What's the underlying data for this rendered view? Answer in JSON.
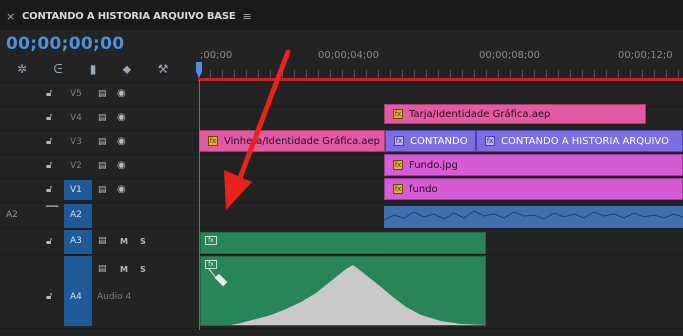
{
  "panel": {
    "close_glyph": "×",
    "title": "CONTANDO A HISTORIA ARQUIVO BASE",
    "menu_glyph": "≡"
  },
  "timecode": "00;00;00;00",
  "tools": [
    {
      "name": "snap-icon",
      "glyph": "✲"
    },
    {
      "name": "linked-selection-icon",
      "glyph": "ᕮ"
    },
    {
      "name": "add-marker-icon",
      "glyph": "▮"
    },
    {
      "name": "marker-icon",
      "glyph": "⬥"
    },
    {
      "name": "wrench-icon",
      "glyph": "⚒"
    }
  ],
  "ruler": {
    "labels": [
      ";00;00",
      "00;00;04;00",
      "00;00;08;00",
      "00;00;12;0"
    ]
  },
  "tracks": {
    "v5": "V5",
    "v4": "V4",
    "v3": "V3",
    "v2": "V2",
    "v1": "V1",
    "a2_source": "A2",
    "a2": "A2",
    "a3": "A3",
    "a4": "A4",
    "audio4_name": "Audio 4",
    "mute": "M",
    "solo": "S"
  },
  "clips": {
    "tarja": "Tarja/Identidade Gráfica.aep",
    "vinheta": "Vinheta/Identidade Gráfica.aep",
    "contando_short": "CONTANDO",
    "contando_full": "CONTANDO A HISTORIA ARQUIVO",
    "fundo_jpg": "Fundo.jpg",
    "fundo": "fundo"
  },
  "colors": {
    "timecode": "#4f8fdc",
    "pink_clip": "#e25aa0",
    "magenta_clip": "#d65bd4",
    "violet_clip": "#7c6ee0",
    "audio_blue": "#3f6fb0",
    "audio_green": "#28855a",
    "annotation_arrow": "#e8231c"
  }
}
